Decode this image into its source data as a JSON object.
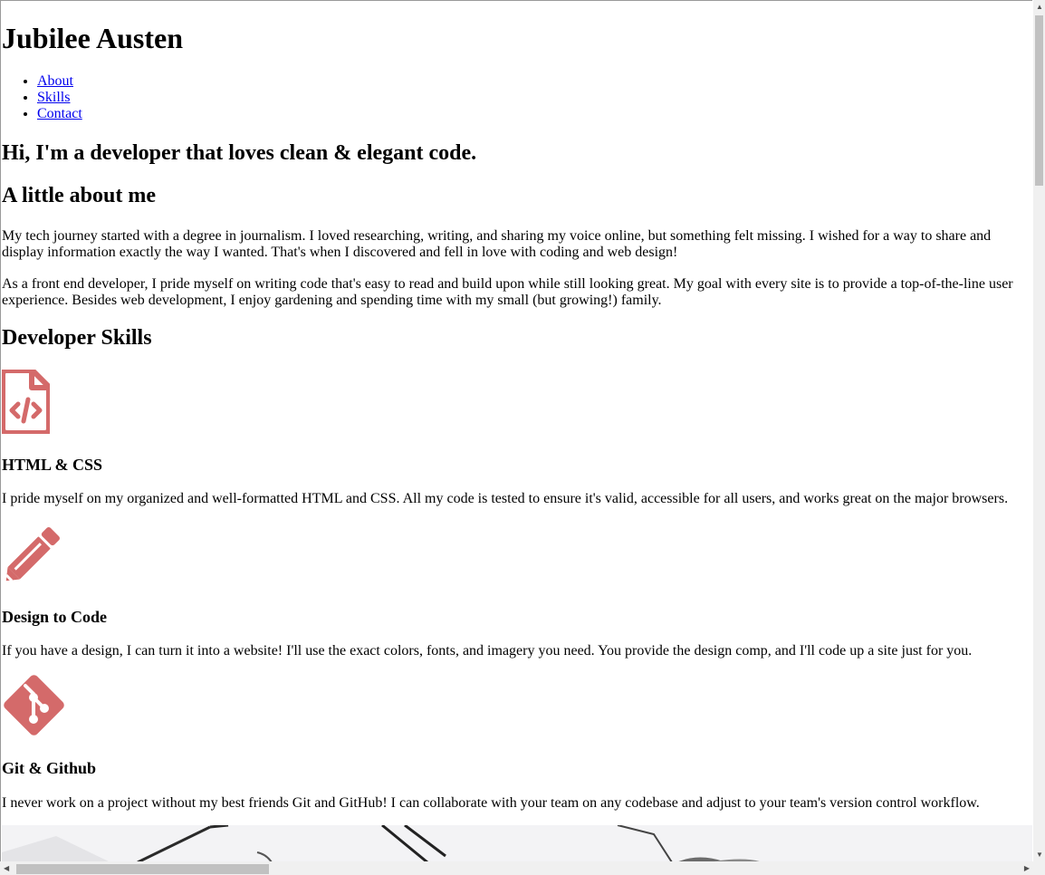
{
  "site": {
    "name": "Jubilee Austen"
  },
  "nav": {
    "items": [
      "About",
      "Skills",
      "Contact"
    ]
  },
  "hero": {
    "headline": "Hi, I'm a developer that loves clean & elegant code."
  },
  "about": {
    "title": "A little about me",
    "paragraphs": [
      "My tech journey started with a degree in journalism. I loved researching, writing, and sharing my voice online, but something felt missing. I wished for a way to share and display information exactly the way I wanted. That's when I discovered and fell in love with coding and web design!",
      "As a front end developer, I pride myself on writing code that's easy to read and build upon while still looking great. My goal with every site is to provide a top-of-the-line user experience. Besides web development, I enjoy gardening and spending time with my small (but growing!) family."
    ]
  },
  "skills": {
    "title": "Developer Skills",
    "items": [
      {
        "icon": "file-code-icon",
        "title": "HTML & CSS",
        "description": "I pride myself on my organized and well-formatted HTML and CSS. All my code is tested to ensure it's valid, accessible for all users, and works great on the major browsers."
      },
      {
        "icon": "pencil-icon",
        "title": "Design to Code",
        "description": "If you have a design, I can turn it into a website! I'll use the exact colors, fonts, and imagery you need. You provide the design comp, and I'll code up a site just for you."
      },
      {
        "icon": "git-icon",
        "title": "Git & Github",
        "description": "I never work on a project without my best friends Git and GitHub! I can collaborate with your team on any codebase and adjust to your team's version control workflow."
      }
    ]
  },
  "colors": {
    "icon": "#d46a6a",
    "link": "#0000ee",
    "scrollbar_thumb": "#c1c1c1",
    "scrollbar_track": "#f0f0f0"
  },
  "scroll": {
    "horizontal_position": 0.0,
    "vertical_position": 0.0
  }
}
